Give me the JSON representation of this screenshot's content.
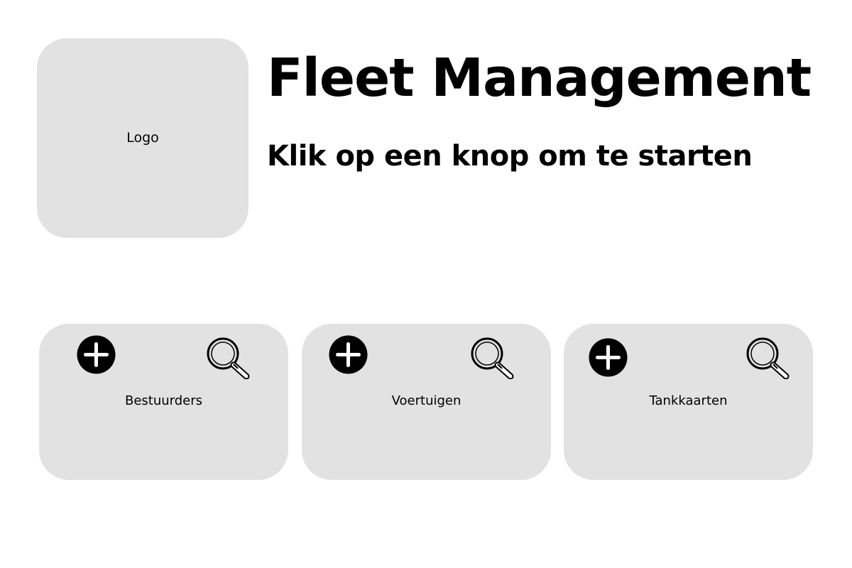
{
  "logo": {
    "label": "Logo"
  },
  "header": {
    "title": "Fleet Management",
    "subtitle": "Klik op een knop om te starten"
  },
  "cards": [
    {
      "label": "Bestuurders",
      "icons": [
        "add-icon",
        "search-icon"
      ]
    },
    {
      "label": "Voertuigen",
      "icons": [
        "add-icon",
        "search-icon"
      ]
    },
    {
      "label": "Tankkaarten",
      "icons": [
        "add-icon",
        "search-icon"
      ]
    }
  ],
  "colors": {
    "background": "#ffffff",
    "card": "#e2e2e2",
    "text": "#000000"
  }
}
